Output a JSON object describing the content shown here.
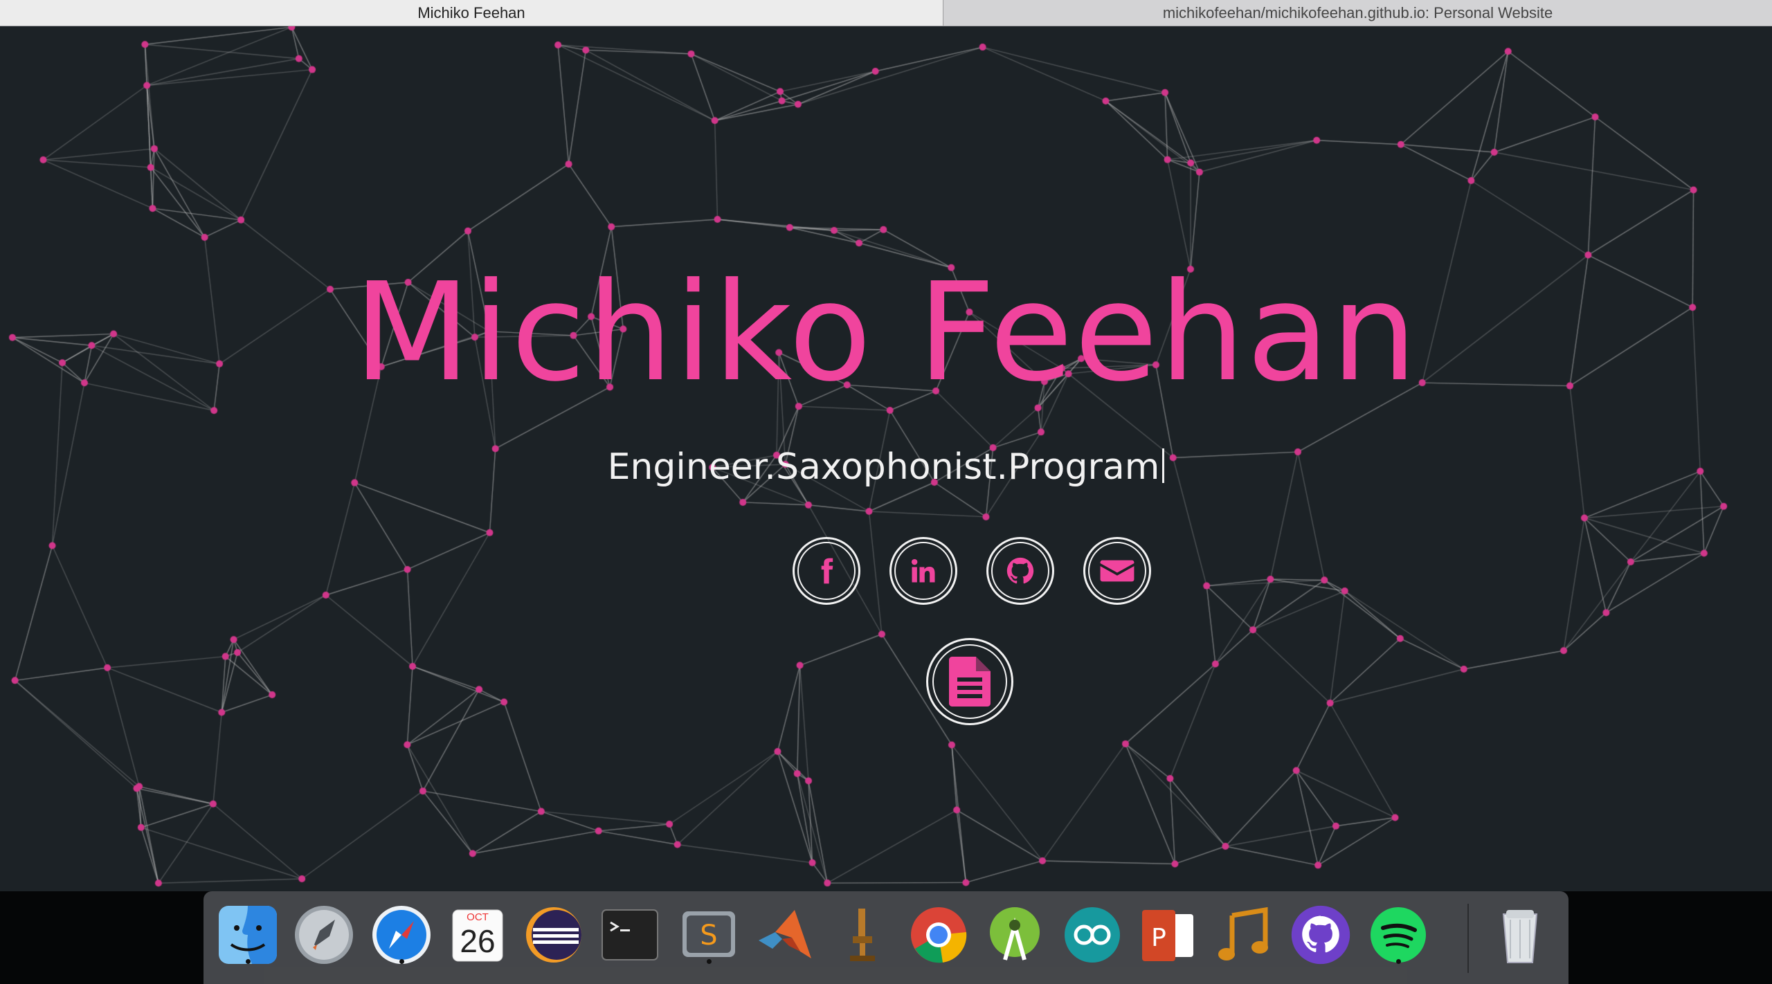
{
  "browser": {
    "tabs": [
      {
        "label": "Michiko Feehan",
        "active": true
      },
      {
        "label": "michikofeehan/michikofeehan.github.io: Personal Website",
        "active": false
      }
    ]
  },
  "hero": {
    "title": "Michiko Feehan",
    "typed_subtitle": "Engineer.Saxophonist.Program",
    "accent_color": "#f0449d",
    "background_color": "#1c2226"
  },
  "social_links": [
    {
      "name": "facebook",
      "icon": "facebook-icon"
    },
    {
      "name": "linkedin",
      "icon": "linkedin-icon"
    },
    {
      "name": "github",
      "icon": "github-icon"
    },
    {
      "name": "email",
      "icon": "envelope-icon"
    }
  ],
  "resume_link": {
    "icon": "document-icon"
  },
  "dock": {
    "calendar": {
      "month": "OCT",
      "day": "26"
    },
    "apps": [
      "Finder",
      "Launchpad",
      "Safari",
      "Calendar",
      "Eclipse",
      "Terminal",
      "Sublime Text",
      "MATLAB",
      "Microscope",
      "Google Chrome",
      "Android Studio",
      "Arduino",
      "PowerPoint",
      "Audio",
      "GitHub Desktop",
      "Spotify",
      "Trash"
    ]
  }
}
